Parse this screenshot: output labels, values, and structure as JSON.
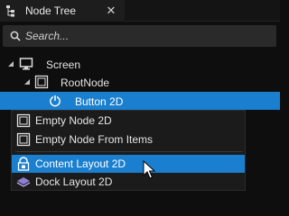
{
  "tab": {
    "title": "Node Tree",
    "close": "✕"
  },
  "search": {
    "placeholder": "Search..."
  },
  "tree": [
    {
      "label": "Screen",
      "icon": "screen-icon",
      "expanded": true
    },
    {
      "label": "RootNode",
      "icon": "empty-node-icon",
      "expanded": true
    },
    {
      "label": "Button 2D",
      "icon": "button-icon",
      "selected": true
    }
  ],
  "menu": {
    "items": [
      {
        "label": "Empty Node 2D",
        "icon": "empty-node-icon"
      },
      {
        "label": "Empty Node From Items",
        "icon": "empty-node-icon"
      },
      {
        "label": "Content Layout 2D",
        "icon": "content-layout-icon",
        "highlighted": true
      },
      {
        "label": "Dock Layout 2D",
        "icon": "dock-layout-icon"
      }
    ]
  },
  "colors": {
    "selection": "#1a7fcf",
    "background": "#0e0e0e",
    "panel": "#1b1b1b"
  }
}
